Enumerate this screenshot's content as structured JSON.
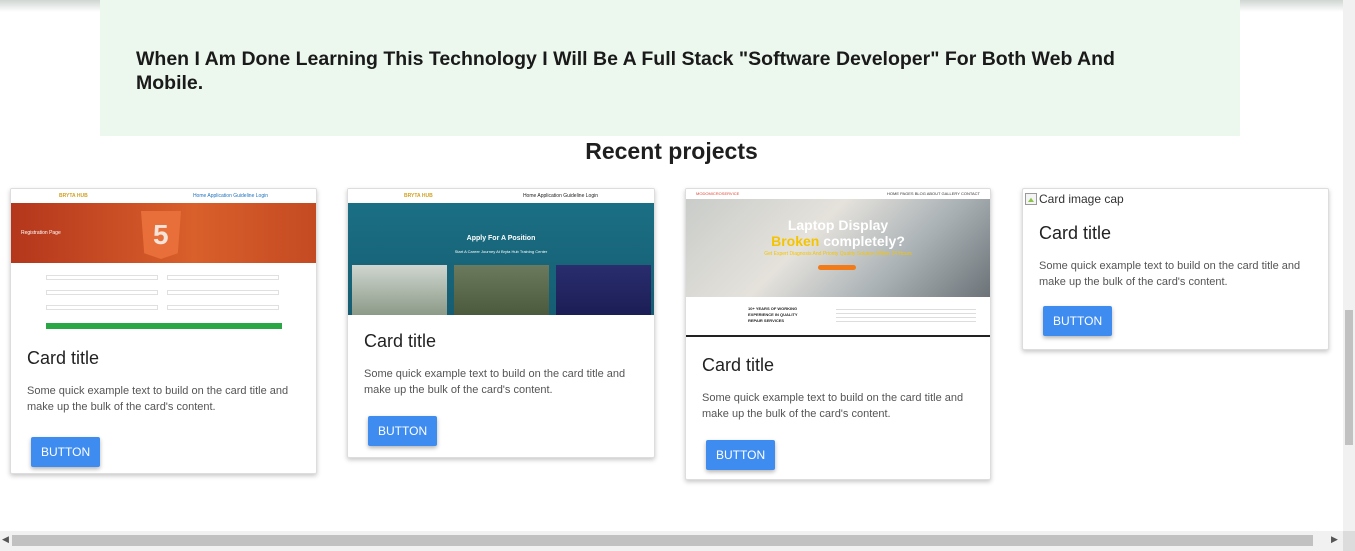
{
  "hero": {
    "statement": "When I Am Done Learning This Technology I Will Be A Full Stack \"Software Developer\" For Both Web And Mobile."
  },
  "projects": {
    "heading": "Recent projects",
    "cards": [
      {
        "title": "Card title",
        "text": "Some quick example text to build on the card title and make up the bulk of the card's content.",
        "button": "BUTTON",
        "preview": {
          "logo": "BRYTA HUB",
          "nav": "Home  Application Guideline  Login",
          "banner": "Registration Page",
          "badge": "5"
        }
      },
      {
        "title": "Card title",
        "text": "Some quick example text to build on the card title and make up the bulk of the card's content.",
        "button": "BUTTON",
        "preview": {
          "logo": "BRYTA HUB",
          "nav": "Home  Application Guideline  Login",
          "headline": "Apply For A Position",
          "subline": "Start A Career Journey At Bryta Hub Training Center"
        }
      },
      {
        "title": "Card title",
        "text": "Some quick example text to build on the card title and make up the bulk of the card's content.",
        "button": "BUTTON",
        "preview": {
          "logo": "MODOMICROSERVICE",
          "nav": "HOME  PAGES  BLOG  ABOUT  GALLERY  CONTACT",
          "line1": "Laptop Display",
          "line2_highlight": "Broken",
          "line2_rest": " completely?",
          "sub": "Get Expert Diagnosis And Priority Quality Solution Within 24 Hours",
          "experience": "10+ YEARS OF WORKING EXPERIENCE IN QUALITY REPAIR SERVICES"
        }
      },
      {
        "title": "Card title",
        "text": "Some quick example text to build on the card title and make up the bulk of the card's content.",
        "button": "BUTTON",
        "image_alt": "Card image cap"
      }
    ]
  },
  "colors": {
    "hero_bg": "#ecf8ee",
    "button": "#3f8cf0",
    "html5": "#e86f3a",
    "highlight": "#f5c400"
  }
}
